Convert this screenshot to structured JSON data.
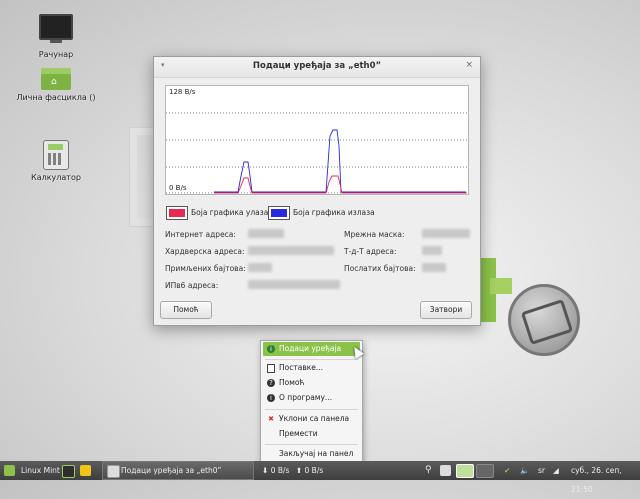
{
  "desktop": {
    "icons": [
      {
        "label": "Рачунар",
        "icon": "computer-icon"
      },
      {
        "label": "Лична фасцикла ()",
        "icon": "home-folder-icon"
      },
      {
        "label": "Калкулатор",
        "icon": "calculator-icon"
      }
    ]
  },
  "dialog": {
    "title": "Подаци уређаја за „eth0”",
    "graph": {
      "top_label": "128 B/s",
      "bottom_label": "0 B/s"
    },
    "legend": {
      "in_label": "Боја графика улаза",
      "in_color": "#e8294f",
      "out_label": "Боја графика излаза",
      "out_color": "#2a28e0"
    },
    "info": {
      "ip_label": "Интернет адреса:",
      "hw_label": "Хардверска адреса:",
      "rx_label": "Примљених бајтова:",
      "ipv6_label": "ИПв6 адреса:",
      "mask_label": "Мрежна маска:",
      "ptp_label": "Т-д-Т адреса:",
      "tx_label": "Послатих бајтова:"
    },
    "help_button": "Помоћ",
    "close_button": "Затвори"
  },
  "context_menu": {
    "items": [
      {
        "label": "Подаци уређаја",
        "icon": "info-icon",
        "active": true
      },
      {
        "label": "Поставке...",
        "icon": "preferences-icon"
      },
      {
        "label": "Помоћ",
        "icon": "help-icon"
      },
      {
        "label": "О програму...",
        "icon": "about-icon"
      },
      {
        "label": "Уклони са панела",
        "icon": "remove-icon"
      },
      {
        "label": "Премести",
        "icon": ""
      },
      {
        "label": "Закључај на панел",
        "icon": ""
      }
    ]
  },
  "panel": {
    "menu_label": "Linux Mint",
    "window_button": "Подаци уређаја за „eth0”",
    "net_down": "0 B/s",
    "net_up": "0 B/s",
    "keyboard_layout": "sr",
    "clock": "суб., 26. сеп, 21:50"
  },
  "colors": {
    "accent": "#8bc34a",
    "panel": "#4a4a4a"
  }
}
